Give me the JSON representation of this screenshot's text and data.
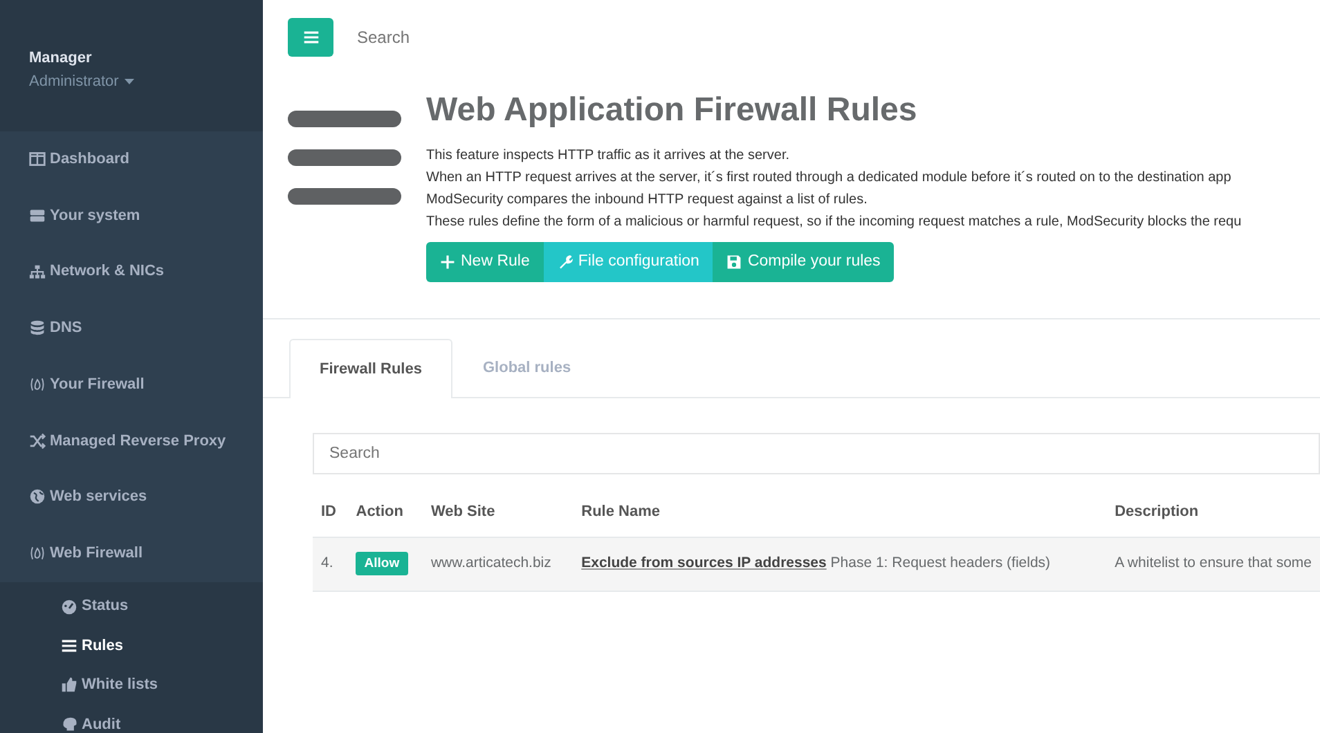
{
  "sidebar": {
    "user": {
      "name": "Manager",
      "role": "Administrator"
    },
    "items": [
      {
        "label": "Dashboard",
        "selected": false
      },
      {
        "label": "Your system",
        "selected": false
      },
      {
        "label": "Network & NICs",
        "selected": false
      },
      {
        "label": "DNS",
        "selected": false
      },
      {
        "label": "Your Firewall",
        "selected": false
      },
      {
        "label": "Managed Reverse Proxy",
        "selected": false
      },
      {
        "label": "Web services",
        "selected": false
      },
      {
        "label": "Web Firewall",
        "selected": false,
        "children": [
          {
            "label": "Status",
            "selected": false
          },
          {
            "label": "Rules",
            "selected": true
          },
          {
            "label": "White lists",
            "selected": false
          },
          {
            "label": "Audit",
            "selected": false
          }
        ]
      }
    ]
  },
  "topbar": {
    "search": {
      "placeholder": "Search"
    }
  },
  "header": {
    "title": "Web Application Firewall Rules",
    "description": [
      "This feature inspects HTTP traffic as it arrives at the server.",
      "When an HTTP request arrives at the server, it´s first routed through a dedicated module before it´s routed on to the destination app",
      "ModSecurity compares the inbound HTTP request against a list of rules.",
      "These rules define the form of a malicious or harmful request, so if the incoming request matches a rule, ModSecurity blocks the requ"
    ],
    "buttons": [
      {
        "label": "New Rule",
        "kind": "primary"
      },
      {
        "label": "File configuration",
        "kind": "info"
      },
      {
        "label": "Compile your rules",
        "kind": "primary"
      }
    ]
  },
  "tabs": [
    {
      "label": "Firewall Rules",
      "selected": true
    },
    {
      "label": "Global rules",
      "selected": false
    }
  ],
  "table": {
    "search": {
      "placeholder": "Search"
    },
    "columns": [
      "ID",
      "Action",
      "Web Site",
      "Rule Name",
      "Description"
    ],
    "rows": [
      {
        "id": "4.",
        "action": "Allow",
        "website": "www.articatech.biz",
        "rule_link": "Exclude from sources IP addresses",
        "rule_phase": "Phase 1: Request headers (fields)",
        "description": "A whitelist to ensure that some"
      }
    ]
  }
}
